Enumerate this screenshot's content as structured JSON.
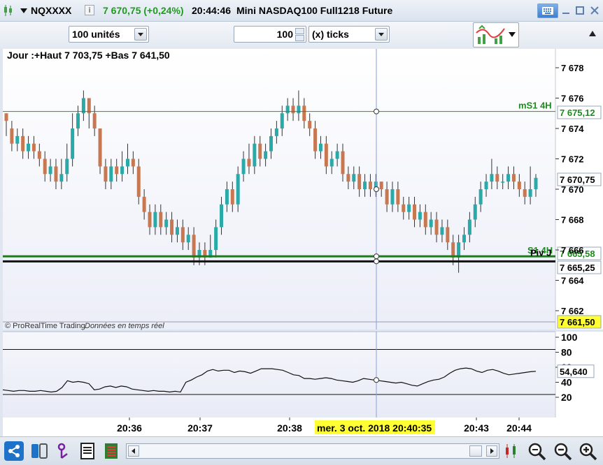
{
  "header": {
    "symbol": "NQXXXX",
    "price_change": "7 670,75 (+0,24%)",
    "time": "20:44:46",
    "instrument": "Mini NASDAQ100 Full1218 Future"
  },
  "toolbar": {
    "units_label": "100 unités",
    "quantity_value": "100",
    "ticks_label": "(x) ticks"
  },
  "chart": {
    "info_label": "Jour :+Haut 7 703,75 +Bas 7 641,50",
    "watermark": "© ProRealTime Trading",
    "data_notice": "Données en temps réel",
    "y_ticks": [
      "7 678",
      "7 676",
      "7 674",
      "7 672",
      "7 670",
      "7 668",
      "7 666",
      "7 664",
      "7 662"
    ],
    "labels": [
      {
        "text": "mS1 4H",
        "color": "#1f8a1f"
      },
      {
        "text": "S1 4H",
        "color": "#1f8a1f"
      },
      {
        "text": "Piv J",
        "color": "#000000"
      }
    ],
    "price_tags": [
      {
        "text": "7 675,12",
        "bg": "#ffffff",
        "fg": "#1f8a1f"
      },
      {
        "text": "7 670,75",
        "bg": "#ffffff",
        "fg": "#000000"
      },
      {
        "text": "7 665,58",
        "bg": "#ffffff",
        "fg": "#1f8a1f"
      },
      {
        "text": "7 665,25",
        "bg": "#ffffff",
        "fg": "#000000"
      },
      {
        "text": "7 661,50",
        "bg": "#ffff33",
        "fg": "#000000"
      }
    ],
    "colors": {
      "up": "#2aa9a9",
      "down": "#c87850",
      "grid": "#9a9ab0",
      "crosshair": "#8aa0dd"
    },
    "indicator": {
      "y_ticks": [
        "100",
        "80",
        "60",
        "40",
        "20"
      ],
      "value_tag": "54,640"
    },
    "x_ticks": [
      "20:36",
      "20:37",
      "20:38",
      "20:43",
      "20:44"
    ],
    "cursor_date": "mer. 3 oct. 2018 20:40:35"
  },
  "chart_data": {
    "type": "candlestick",
    "series": [
      {
        "values": [
          [
            7675,
            7674.5,
            7675,
            7673.5
          ],
          [
            7674,
            7673,
            7674.5,
            7672.5
          ],
          [
            7673,
            7673.5,
            7674,
            7672.5
          ],
          [
            7673.5,
            7672.5,
            7674,
            7672
          ],
          [
            7672.5,
            7673,
            7673.5,
            7672
          ],
          [
            7673,
            7672.5,
            7673.5,
            7672
          ],
          [
            7672.5,
            7672,
            7673,
            7671.5
          ],
          [
            7672,
            7671,
            7672.5,
            7670.5
          ],
          [
            7671,
            7671.5,
            7672,
            7670.5
          ],
          [
            7671.5,
            7670.5,
            7672,
            7670
          ],
          [
            7670.5,
            7671,
            7672,
            7670
          ],
          [
            7671,
            7672,
            7673,
            7670.5
          ],
          [
            7672,
            7674,
            7675,
            7671.5
          ],
          [
            7674,
            7675,
            7675.5,
            7673.5
          ],
          [
            7675,
            7676,
            7676.5,
            7674.5
          ],
          [
            7676,
            7675,
            7676,
            7674
          ],
          [
            7675,
            7674,
            7675.5,
            7673.5
          ],
          [
            7674,
            7671.5,
            7674,
            7671
          ],
          [
            7671.5,
            7670.5,
            7672,
            7670
          ],
          [
            7670.5,
            7671.5,
            7672,
            7670
          ],
          [
            7671.5,
            7671,
            7672,
            7670.5
          ],
          [
            7671,
            7671.5,
            7672.5,
            7670.5
          ],
          [
            7671.5,
            7672,
            7673,
            7671
          ],
          [
            7672,
            7671.5,
            7672.5,
            7671
          ],
          [
            7671.5,
            7669.5,
            7672,
            7669
          ],
          [
            7669.5,
            7668.5,
            7670,
            7668
          ],
          [
            7668.5,
            7667.5,
            7669,
            7667
          ],
          [
            7667.5,
            7668.5,
            7669,
            7667
          ],
          [
            7668.5,
            7667.5,
            7669,
            7667
          ],
          [
            7667.5,
            7668,
            7668.5,
            7667
          ],
          [
            7668,
            7667,
            7668.5,
            7666.5
          ],
          [
            7667,
            7667.5,
            7668,
            7666.5
          ],
          [
            7667.5,
            7666.5,
            7668,
            7666
          ],
          [
            7666.5,
            7667,
            7667.5,
            7666
          ],
          [
            7667,
            7665.5,
            7667.5,
            7665
          ],
          [
            7665.5,
            7666,
            7666.5,
            7665
          ],
          [
            7666,
            7665.5,
            7666.5,
            7665
          ],
          [
            7665.5,
            7666,
            7667,
            7665.5
          ],
          [
            7666,
            7667.5,
            7668,
            7665.5
          ],
          [
            7667.5,
            7669,
            7669.5,
            7667
          ],
          [
            7669,
            7670,
            7670.5,
            7668.5
          ],
          [
            7670,
            7669,
            7670.5,
            7668.5
          ],
          [
            7669,
            7671,
            7671.5,
            7668.5
          ],
          [
            7671,
            7672,
            7672.5,
            7670.5
          ],
          [
            7672,
            7671.5,
            7673,
            7671
          ],
          [
            7671.5,
            7673,
            7673.5,
            7671
          ],
          [
            7673,
            7672,
            7673.5,
            7671.5
          ],
          [
            7672,
            7672.5,
            7673,
            7671.5
          ],
          [
            7672.5,
            7673.5,
            7674,
            7672
          ],
          [
            7673.5,
            7674,
            7674.5,
            7673
          ],
          [
            7674,
            7675,
            7675.5,
            7673.5
          ],
          [
            7675,
            7675.5,
            7676,
            7674.5
          ],
          [
            7675.5,
            7675,
            7676,
            7674.5
          ],
          [
            7675,
            7675.5,
            7676.5,
            7674.5
          ],
          [
            7675.5,
            7674.5,
            7676,
            7674
          ],
          [
            7674.5,
            7674,
            7675,
            7673.5
          ],
          [
            7674,
            7672.5,
            7674.5,
            7672
          ],
          [
            7672.5,
            7673,
            7673.5,
            7672
          ],
          [
            7673,
            7671.5,
            7673.5,
            7671
          ],
          [
            7671.5,
            7672,
            7672.5,
            7671
          ],
          [
            7672,
            7672.5,
            7673,
            7671.5
          ],
          [
            7672.5,
            7671,
            7673,
            7670.5
          ],
          [
            7671,
            7670.5,
            7671.5,
            7670
          ],
          [
            7670.5,
            7671,
            7671.5,
            7670
          ],
          [
            7671,
            7670,
            7671.5,
            7669.5
          ],
          [
            7670,
            7670.5,
            7671,
            7669.5
          ],
          [
            7670.5,
            7670,
            7671,
            7669.5
          ],
          [
            7670,
            7670.5,
            7671,
            7669.5
          ],
          [
            7670.5,
            7670,
            7670.5,
            7669.5
          ],
          [
            7670,
            7669,
            7670.5,
            7668.5
          ],
          [
            7669,
            7670,
            7670.5,
            7668.5
          ],
          [
            7670,
            7669,
            7670.5,
            7668.5
          ],
          [
            7669,
            7668.5,
            7669.5,
            7668
          ],
          [
            7668.5,
            7669,
            7669.5,
            7668
          ],
          [
            7669,
            7668,
            7669.5,
            7667.5
          ],
          [
            7668,
            7668.5,
            7669,
            7667.5
          ],
          [
            7668.5,
            7667.5,
            7669,
            7667
          ],
          [
            7667.5,
            7668,
            7668.5,
            7667
          ],
          [
            7668,
            7667,
            7668.5,
            7666.5
          ],
          [
            7667,
            7667.5,
            7668,
            7666.5
          ],
          [
            7667.5,
            7666.5,
            7668,
            7666
          ],
          [
            7666.5,
            7665.5,
            7667,
            7665
          ],
          [
            7665.5,
            7666.5,
            7667,
            7664.5
          ],
          [
            7666.5,
            7667,
            7667.5,
            7666
          ],
          [
            7667,
            7668,
            7668.5,
            7666.5
          ],
          [
            7668,
            7669,
            7669.5,
            7667.5
          ],
          [
            7669,
            7670,
            7670.5,
            7668.5
          ],
          [
            7670,
            7670.5,
            7671,
            7669.5
          ],
          [
            7670.5,
            7671,
            7672,
            7670
          ],
          [
            7671,
            7670.5,
            7671.5,
            7670
          ],
          [
            7670.5,
            7670.5,
            7671,
            7670
          ],
          [
            7670.5,
            7671,
            7671.5,
            7670
          ],
          [
            7671,
            7670.5,
            7671.5,
            7670
          ],
          [
            7670.5,
            7670,
            7671,
            7669.5
          ],
          [
            7670,
            7669.5,
            7670.5,
            7669
          ],
          [
            7669.5,
            7670,
            7671.5,
            7669
          ],
          [
            7670,
            7670.75,
            7671,
            7669.5
          ]
        ]
      }
    ],
    "horizontal_lines": [
      {
        "name": "mS1 4H",
        "value": 7675.12
      },
      {
        "name": "S1 4H",
        "value": 7665.58
      },
      {
        "name": "Piv J",
        "value": 7665.25
      }
    ],
    "indicator_series": [
      30,
      29,
      28,
      29,
      29,
      28,
      28,
      29,
      28,
      27,
      28,
      33,
      42,
      40,
      41,
      40,
      38,
      30,
      31,
      34,
      35,
      33,
      35,
      34,
      31,
      30,
      29,
      28,
      29,
      28,
      28,
      27,
      28,
      27,
      40,
      43,
      47,
      50,
      55,
      57,
      55,
      56,
      56,
      53,
      55,
      54,
      52,
      55,
      58,
      58,
      58,
      57,
      56,
      53,
      50,
      49,
      45,
      45,
      44,
      45,
      46,
      45,
      43,
      42,
      41,
      40,
      42,
      45,
      44,
      43,
      42,
      41,
      40,
      39,
      40,
      38,
      36,
      35,
      38,
      41,
      43,
      44,
      47,
      52,
      56,
      58,
      59,
      58,
      55,
      53,
      56,
      57,
      55,
      52,
      50,
      51,
      52,
      53,
      54,
      54.64
    ],
    "x_ticks": [
      "20:36",
      "20:37",
      "20:38",
      "20:43",
      "20:44"
    ],
    "y_ticks": [
      "7 678",
      "7 676",
      "7 674",
      "7 672",
      "7 670",
      "7 668",
      "7 666",
      "7 664",
      "7 662"
    ],
    "ylim": [
      7661.5,
      7679.5
    ],
    "indicator_ylim": [
      0,
      110
    ]
  }
}
